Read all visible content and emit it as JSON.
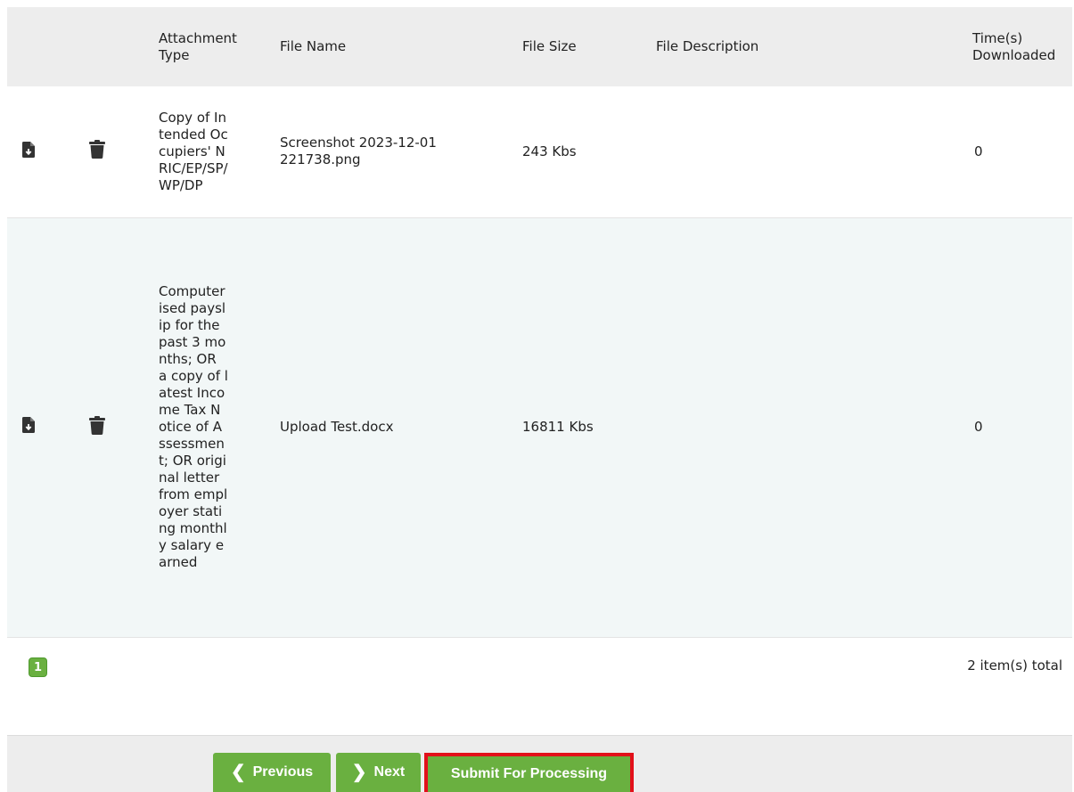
{
  "table": {
    "headers": {
      "attachment_type": "Attachment Type",
      "file_name": "File Name",
      "file_size": "File Size",
      "file_description": "File Description",
      "times_downloaded": "Time(s) Downloaded"
    },
    "rows": [
      {
        "download_icon": "file-download-icon",
        "delete_icon": "trash-icon",
        "attachment_type": "Copy of Intended Occupiers' NRIC/EP/SP/WP/DP",
        "file_name": "Screenshot 2023-12-01 221738.png",
        "file_size": "243 Kbs",
        "file_description": "",
        "times_downloaded": "0"
      },
      {
        "download_icon": "file-download-icon",
        "delete_icon": "trash-icon",
        "attachment_type": "Computerised payslip for the past 3 months; OR a copy of latest Income Tax Notice of Assessment; OR original letter from employer stating monthly salary earned",
        "file_name": "Upload Test.docx",
        "file_size": "16811 Kbs",
        "file_description": "",
        "times_downloaded": "0"
      }
    ]
  },
  "pagination": {
    "current_page": "1",
    "total_text": "2 item(s) total"
  },
  "buttons": {
    "previous": "Previous",
    "next": "Next",
    "submit": "Submit For Processing"
  },
  "colors": {
    "accent_green": "#6ab040",
    "highlight_red": "#e2101a",
    "header_bg": "#ededed",
    "alt_row_bg": "#f2f7f7"
  }
}
